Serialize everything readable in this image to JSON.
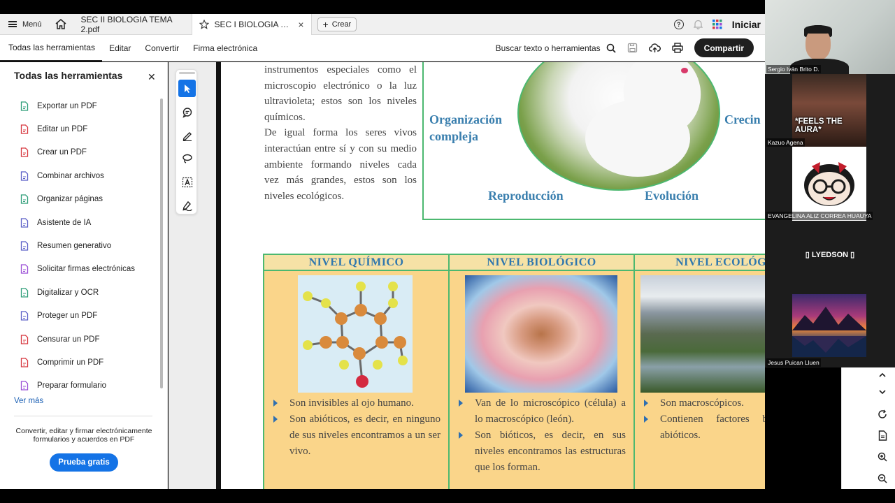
{
  "tabbar": {
    "menu_label": "Menú",
    "tabs": [
      {
        "label": "SEC II BIOLOGIA TEMA 2.pdf"
      },
      {
        "label": "SEC I BIOLOGIA TE..."
      }
    ],
    "create_label": "Crear",
    "signin_label": "Iniciar"
  },
  "toolbar": {
    "items": [
      "Todas las herramientas",
      "Editar",
      "Convertir",
      "Firma electrónica"
    ],
    "search_label": "Buscar texto o herramientas",
    "share_label": "Compartir"
  },
  "leftpanel": {
    "title": "Todas las herramientas",
    "items": [
      {
        "label": "Exportar un PDF",
        "icon": "export-pdf-icon",
        "color": "#2d9d78"
      },
      {
        "label": "Editar un PDF",
        "icon": "edit-pdf-icon",
        "color": "#d7373f"
      },
      {
        "label": "Crear un PDF",
        "icon": "create-pdf-icon",
        "color": "#d7373f"
      },
      {
        "label": "Combinar archivos",
        "icon": "combine-files-icon",
        "color": "#5b5fc7"
      },
      {
        "label": "Organizar páginas",
        "icon": "organize-pages-icon",
        "color": "#2d9d78"
      },
      {
        "label": "Asistente de IA",
        "icon": "ai-assistant-icon",
        "color": "#5b5fc7"
      },
      {
        "label": "Resumen generativo",
        "icon": "generative-summary-icon",
        "color": "#5b5fc7"
      },
      {
        "label": "Solicitar firmas electrónicas",
        "icon": "request-signature-icon",
        "color": "#9b4fd6"
      },
      {
        "label": "Digitalizar y OCR",
        "icon": "scan-ocr-icon",
        "color": "#2d9d78"
      },
      {
        "label": "Proteger un PDF",
        "icon": "protect-pdf-icon",
        "color": "#5b5fc7"
      },
      {
        "label": "Censurar un PDF",
        "icon": "redact-pdf-icon",
        "color": "#d7373f"
      },
      {
        "label": "Comprimir un PDF",
        "icon": "compress-pdf-icon",
        "color": "#d7373f"
      },
      {
        "label": "Preparar formulario",
        "icon": "prepare-form-icon",
        "color": "#9b4fd6"
      }
    ],
    "more_label": "Ver más",
    "promo_text": "Convertir, editar y firmar electrónicamente formularios y acuerdos en PDF",
    "trial_label": "Prueba gratis"
  },
  "document": {
    "paragraph1": "instrumentos especiales como el microscopio electrónico o la luz ultravioleta; estos son los niveles químicos.",
    "paragraph2": "De igual forma los seres vivos interactúan entre sí y con su medio ambiente formando niveles cada vez más grandes, estos son los niveles ecológicos.",
    "circle_labels": {
      "organization": "Organización compleja",
      "growth": "Crecin",
      "reproduction": "Reproducción",
      "evolution": "Evolución"
    },
    "levels": [
      {
        "heading": "NIVEL QUÍMICO",
        "bullets": [
          "Son invisibles al ojo humano.",
          "Son abióticos, es decir, en ninguno de sus niveles encontramos a un ser vivo."
        ]
      },
      {
        "heading": "NIVEL BIOLÓGICO",
        "bullets": [
          "Van de lo microscópico (célula) a lo macroscópico (león).",
          "Son bióticos, es decir, en sus niveles encontramos las estructuras que los forman."
        ]
      },
      {
        "heading": "NIVEL ECOLÓGIC",
        "bullets": [
          "Son macroscópicos.",
          "Contienen factores bióticos y abióticos."
        ]
      }
    ]
  },
  "video": {
    "participants": [
      {
        "name": "Sergio Iván Brito D."
      },
      {
        "name": "Kazuo Agena",
        "overlay_text": "*FEELS THE AURA*"
      },
      {
        "name": "EVANGELINA ALIZ CORREA HUAUYA"
      },
      {
        "name": "▯ LYEDSON ▯"
      },
      {
        "name": "Jesus Puican Lluen"
      }
    ]
  },
  "colors": {
    "accent": "#1473e6",
    "level_border": "#4cb870",
    "level_fill": "#fad58a",
    "heading_blue": "#2f77ae"
  }
}
